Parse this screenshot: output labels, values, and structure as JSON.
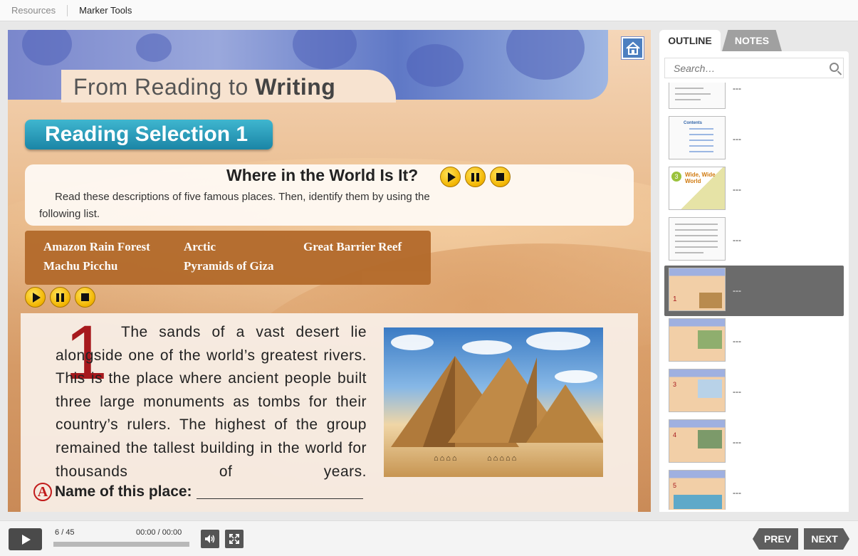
{
  "menu": {
    "resources": "Resources",
    "marker_tools": "Marker Tools"
  },
  "slide": {
    "title_plain": "From Reading to ",
    "title_bold": "Writing",
    "selection_label": "Reading Selection 1",
    "question_title": "Where in the World Is It?",
    "instructions": "Read these descriptions of five famous places. Then, identify them by using the following list.",
    "places": [
      "Amazon Rain Forest",
      "Arctic",
      "Great Barrier Reef",
      "Machu Picchu",
      "Pyramids of Giza"
    ],
    "number": "1",
    "paragraph": "The sands of a vast desert lie alongside one of the world’s greatest rivers. This is the place where ancient people built three large monuments as tombs for their country’s rulers. The highest of the group remained the tallest building in the world for thousands of years.",
    "answer_letter": "A",
    "answer_label": "Name of this place:"
  },
  "sidebar": {
    "tab_outline": "OUTLINE",
    "tab_notes": "NOTES",
    "search_placeholder": "Search…",
    "thumbnails": [
      {
        "label": "---",
        "selected": false
      },
      {
        "label": "---",
        "selected": false
      },
      {
        "label": "---",
        "selected": false
      },
      {
        "label": "---",
        "selected": false
      },
      {
        "label": "---",
        "selected": true
      },
      {
        "label": "---",
        "selected": false
      },
      {
        "label": "---",
        "selected": false
      },
      {
        "label": "---",
        "selected": false
      },
      {
        "label": "---",
        "selected": false
      }
    ],
    "thumb_text": {
      "wide": "Wide, Wide World",
      "contents": "Contents",
      "num3": "3",
      "num4": "4",
      "num5": "5",
      "num1": "1"
    }
  },
  "player": {
    "current_page": "6",
    "page_sep": "/",
    "total_pages": "45",
    "time_current": "00:00",
    "time_sep": "/",
    "time_total": "00:00",
    "progress_fraction": 0.0,
    "prev_label": "PREV",
    "next_label": "NEXT"
  },
  "colors": {
    "accent_teal": "#1b85a6",
    "list_brown": "#b36a2b",
    "number_red": "#a7191d",
    "selected_row": "#6b6b6b"
  }
}
